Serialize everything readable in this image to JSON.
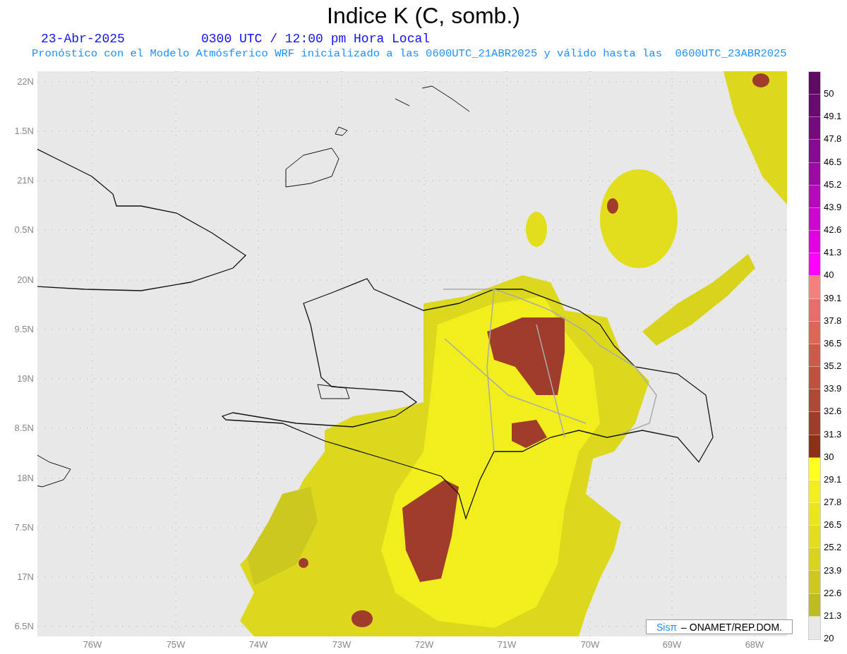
{
  "title": "Indice K (C, somb.)",
  "date": "23-Abr-2025",
  "time": "0300 UTC / 12:00 pm Hora Local",
  "subtitle": "Pronóstico con el Modelo Atmósferico WRF inicializado a las 0600UTC_21ABR2025 y válido hasta las  0600UTC_23ABR2025",
  "map": {
    "lat_labels": [
      "22N",
      "1.5N",
      "21N",
      "0.5N",
      "20N",
      "9.5N",
      "19N",
      "8.5N",
      "18N",
      "7.5N",
      "17N",
      "6.5N"
    ],
    "lon_labels": [
      "76W",
      "75W",
      "74W",
      "73W",
      "72W",
      "71W",
      "70W",
      "69W",
      "68W"
    ],
    "credit": {
      "logo": "Sisπ",
      "text": "– ONAMET/REP.DOM."
    }
  },
  "legend": {
    "bands": [
      {
        "color": "#5e0a62"
      },
      {
        "color": "#6a0a6e"
      },
      {
        "color": "#760a7e"
      },
      {
        "color": "#880a92"
      },
      {
        "color": "#9c0aa6"
      },
      {
        "color": "#b40abc"
      },
      {
        "color": "#cc08d0"
      },
      {
        "color": "#e400e4"
      },
      {
        "color": "#ff00ff"
      },
      {
        "color": "#f57f7f"
      },
      {
        "color": "#e86c6c"
      },
      {
        "color": "#de6658"
      },
      {
        "color": "#cc5a4a"
      },
      {
        "color": "#c05040"
      },
      {
        "color": "#b04838"
      },
      {
        "color": "#a03c2c"
      },
      {
        "color": "#8c3018"
      },
      {
        "color": "#ffff1e"
      },
      {
        "color": "#f2ee1e"
      },
      {
        "color": "#eae61e"
      },
      {
        "color": "#e2de1e"
      },
      {
        "color": "#d8d41e"
      },
      {
        "color": "#ccc820"
      },
      {
        "color": "#bcbc20"
      },
      {
        "color": "#e8e8e8"
      }
    ],
    "labels": [
      "50",
      "49.1",
      "47.8",
      "46.5",
      "45.2",
      "43.9",
      "42.6",
      "41.3",
      "40",
      "39.1",
      "37.8",
      "36.5",
      "35.2",
      "33.9",
      "32.6",
      "31.3",
      "30",
      "29.1",
      "27.8",
      "26.5",
      "25.2",
      "23.9",
      "22.6",
      "21.3",
      "20"
    ]
  }
}
